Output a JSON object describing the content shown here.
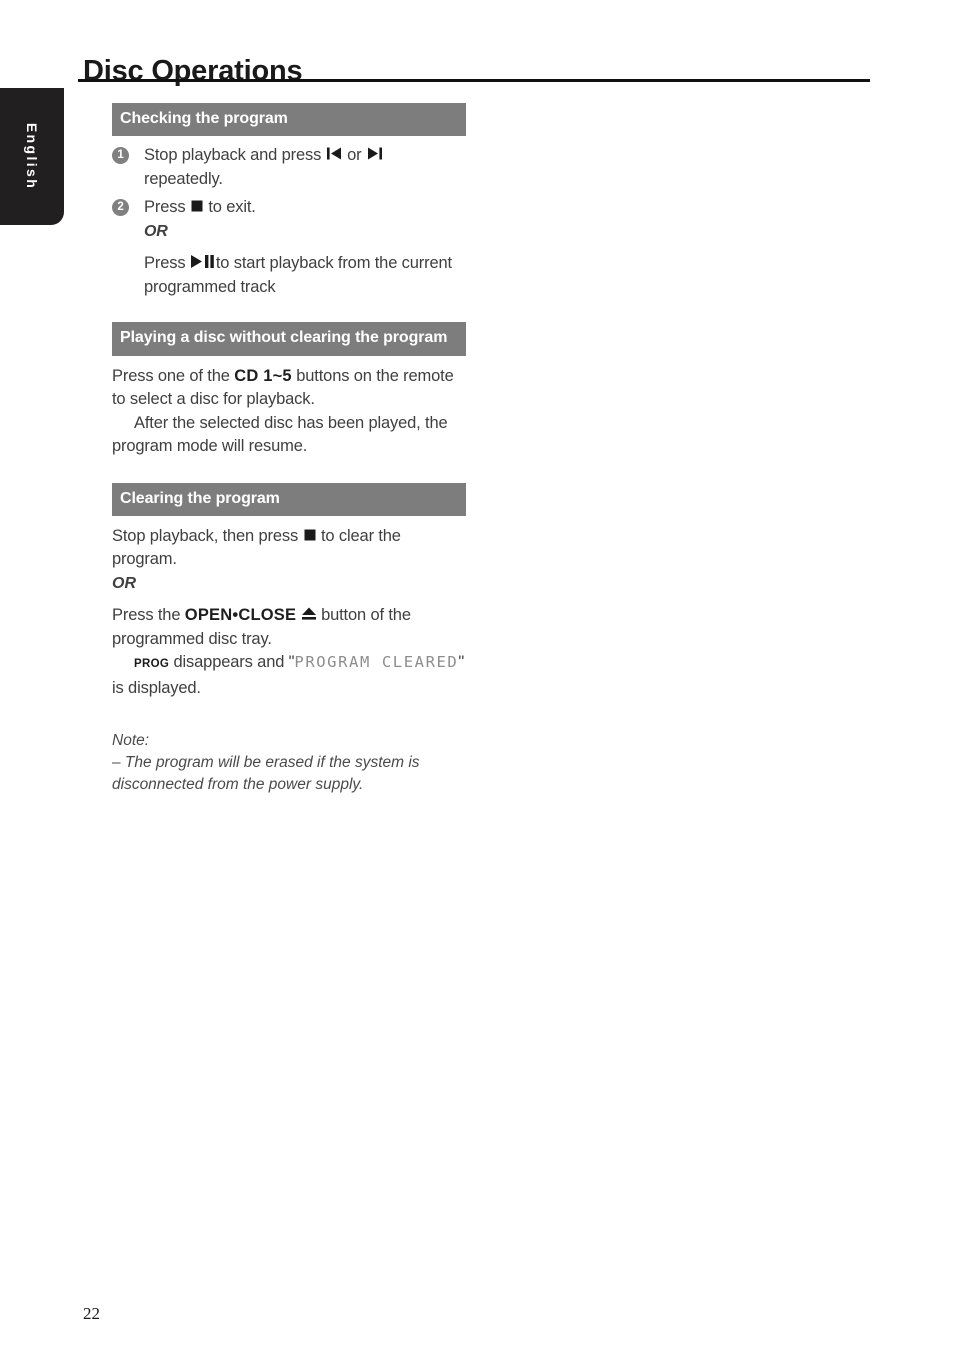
{
  "language_tab": {
    "label": "English"
  },
  "header": {
    "title": "Disc Operations"
  },
  "footer": {
    "page_number": "22"
  },
  "colors": {
    "section_bar": "#7d7d7d",
    "tab_background": "#221f20",
    "bullet": "#808080",
    "lcd_text": "#8d8d8d",
    "rule": "#111111"
  },
  "sections": [
    {
      "heading": "Checking the program",
      "steps": [
        {
          "number": "1",
          "text_before": "Stop playback and press",
          "icon_1": "previous-track-icon",
          "text_middle": "or",
          "icon_2": "next-track-icon",
          "text_after": "repeatedly."
        },
        {
          "number": "2",
          "text_before": "Press",
          "icon_1": "stop-icon",
          "text_after": "to exit.",
          "or_label": "OR",
          "alt_text_before": "Press",
          "alt_icon": "play-pause-icon",
          "alt_text_after": "to start playback from the current programmed track"
        }
      ]
    },
    {
      "heading": "Playing a disc without clearing the program",
      "paragraph_1_part_1": "Press one of the",
      "paragraph_1_bold": "CD 1~5",
      "paragraph_1_part_2": "buttons on the remote to select a disc for playback.",
      "paragraph_2": "After the selected disc has been played, the program mode will resume."
    },
    {
      "heading": "Clearing the program",
      "paragraph_1_part_1": "Stop playback, then press",
      "paragraph_1_icon": "stop-icon",
      "paragraph_1_part_2": "to clear the program.",
      "or_label": "OR",
      "paragraph_2_part_1": "Press the",
      "paragraph_2_bold": "OPEN•CLOSE",
      "paragraph_2_icon": "eject-icon",
      "paragraph_2_part_2": "button of the programmed disc tray.",
      "paragraph_3_badge": "PROG",
      "paragraph_3_part_1": "disappears and \"",
      "paragraph_3_lcd": "PROGRAM CLEARED",
      "paragraph_3_part_2": "\" is displayed."
    }
  ],
  "note": {
    "title": "Note:",
    "items": [
      "–  The program will be erased if the system is disconnected from the power supply."
    ]
  }
}
